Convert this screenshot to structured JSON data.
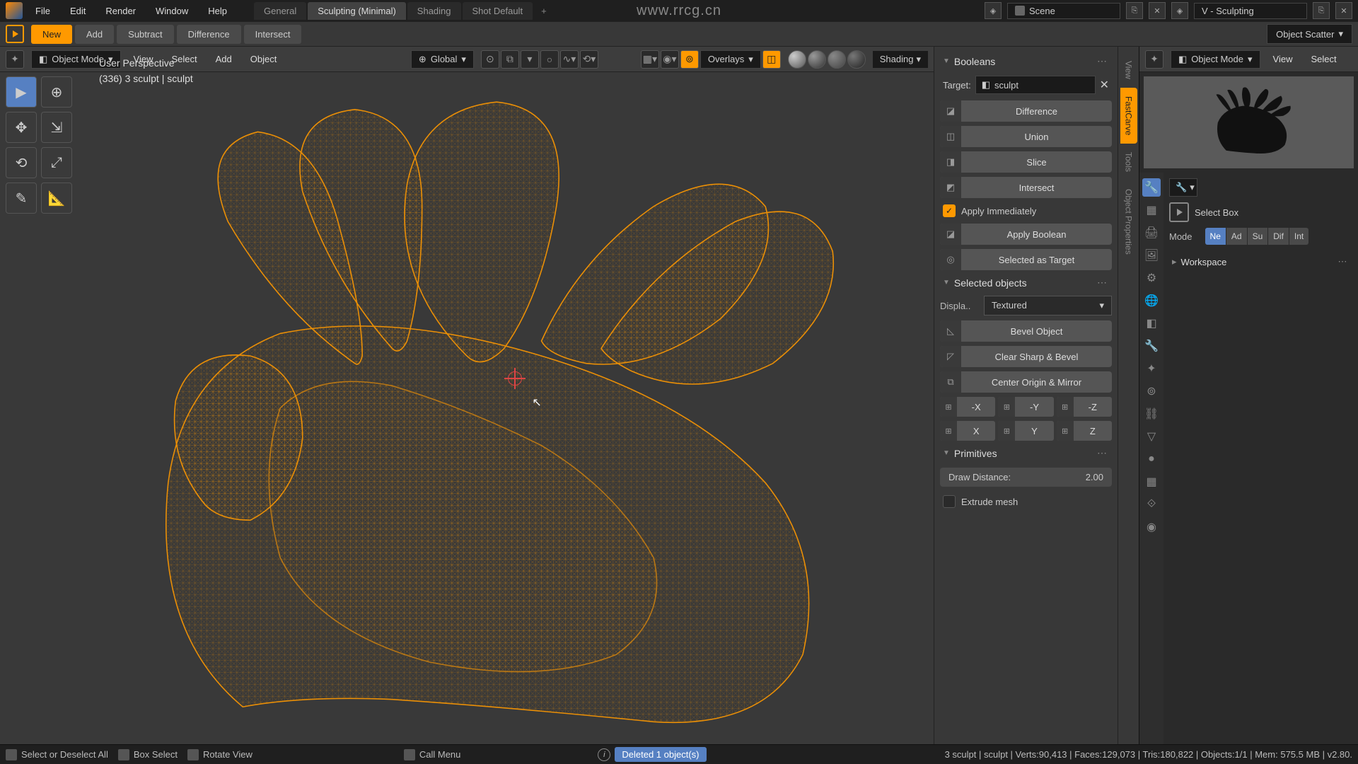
{
  "watermark": "www.rrcg.cn",
  "topMenu": {
    "items": [
      "File",
      "Edit",
      "Render",
      "Window",
      "Help"
    ],
    "workspaces": [
      "General",
      "Sculpting (Minimal)",
      "Shading",
      "Shot Default"
    ],
    "activeWorkspace": 1,
    "scene": {
      "label": "Scene"
    },
    "viewLayer": {
      "label": "V - Sculpting"
    }
  },
  "toolbar": {
    "buttons": [
      "New",
      "Add",
      "Subtract",
      "Difference",
      "Intersect"
    ],
    "active": 0,
    "objectScatter": "Object Scatter"
  },
  "viewport": {
    "modeDropdown": "Object Mode",
    "menus": [
      "View",
      "Select",
      "Add",
      "Object"
    ],
    "transformOrient": "Global",
    "overlays": "Overlays",
    "shading": "Shading",
    "info": {
      "line1": "User Perspective",
      "line2": "(336) 3 sculpt | sculpt"
    }
  },
  "booleansPanel": {
    "title": "Booleans",
    "targetLabel": "Target:",
    "targetValue": "sculpt",
    "ops": [
      "Difference",
      "Union",
      "Slice",
      "Intersect"
    ],
    "applyImmediately": "Apply Immediately",
    "applyBoolean": "Apply Boolean",
    "selectedAsTarget": "Selected as Target",
    "selectedObjects": "Selected objects",
    "displayLabel": "Displa..",
    "displayValue": "Textured",
    "bevelObject": "Bevel Object",
    "clearSharp": "Clear Sharp & Bevel",
    "centerOrigin": "Center Origin & Mirror",
    "axesNeg": [
      "-X",
      "-Y",
      "-Z"
    ],
    "axesPos": [
      "X",
      "Y",
      "Z"
    ],
    "primitives": "Primitives",
    "drawDistance": {
      "label": "Draw Distance:",
      "value": "2.00"
    },
    "extrudeMesh": "Extrude mesh"
  },
  "vertTabs": [
    "View",
    "FastCarve",
    "Tools",
    "Object Properties"
  ],
  "rightPanel": {
    "modeDropdown": "Object Mode",
    "menus": [
      "View",
      "Select"
    ],
    "selectBox": "Select Box",
    "modeLabel": "Mode",
    "modeOpts": [
      "Ne",
      "Ad",
      "Su",
      "Dif",
      "Int"
    ],
    "workspace": "Workspace"
  },
  "statusBar": {
    "items": [
      "Select or Deselect All",
      "Box Select",
      "Rotate View",
      "Call Menu"
    ],
    "deleted": "Deleted 1 object(s)",
    "stats": "3 sculpt | sculpt | Verts:90,413 | Faces:129,073 | Tris:180,822 | Objects:1/1 | Mem: 575.5 MB | v2.80."
  }
}
